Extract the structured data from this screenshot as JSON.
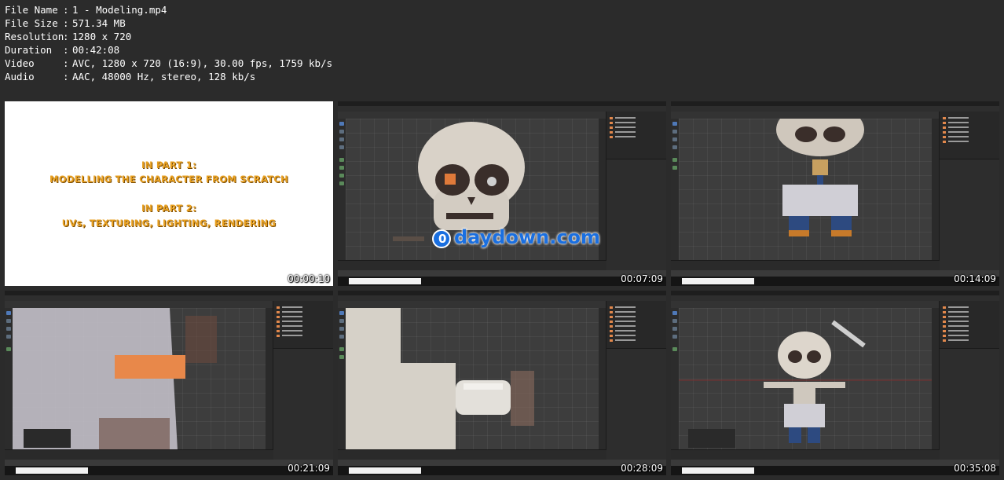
{
  "file_info": [
    {
      "key": "File Name",
      "value": "1 - Modeling.mp4"
    },
    {
      "key": "File Size",
      "value": "571.34 MB"
    },
    {
      "key": "Resolution",
      "value": "1280 x 720"
    },
    {
      "key": "Duration",
      "value": "00:42:08"
    },
    {
      "key": "Video",
      "value": "AVC, 1280 x 720 (16:9), 30.00 fps, 1759 kb/s"
    },
    {
      "key": "Audio",
      "value": "AAC, 48000 Hz, stereo, 128 kb/s"
    }
  ],
  "separator": ":",
  "title_card": {
    "line1": "IN PART 1:",
    "line2": "MODELLING THE CHARACTER FROM SCRATCH",
    "line3": "IN PART 2:",
    "line4": "UVs, TEXTURING, LIGHTING, RENDERING"
  },
  "watermark": "daydown.com",
  "thumbnails": [
    {
      "timestamp": "00:00:10",
      "scene": "title-card"
    },
    {
      "timestamp": "00:07:09",
      "scene": "blender-skull-closeup"
    },
    {
      "timestamp": "00:14:09",
      "scene": "blender-body-front"
    },
    {
      "timestamp": "00:21:09",
      "scene": "blender-cloth-closeup"
    },
    {
      "timestamp": "00:28:09",
      "scene": "blender-arm-closeup"
    },
    {
      "timestamp": "00:35:08",
      "scene": "blender-full-character"
    }
  ],
  "colors": {
    "background": "#2b2b2b",
    "title_text": "#e8a020",
    "watermark": "#1a6fe0",
    "blender_viewport": "#3d3d3d"
  }
}
